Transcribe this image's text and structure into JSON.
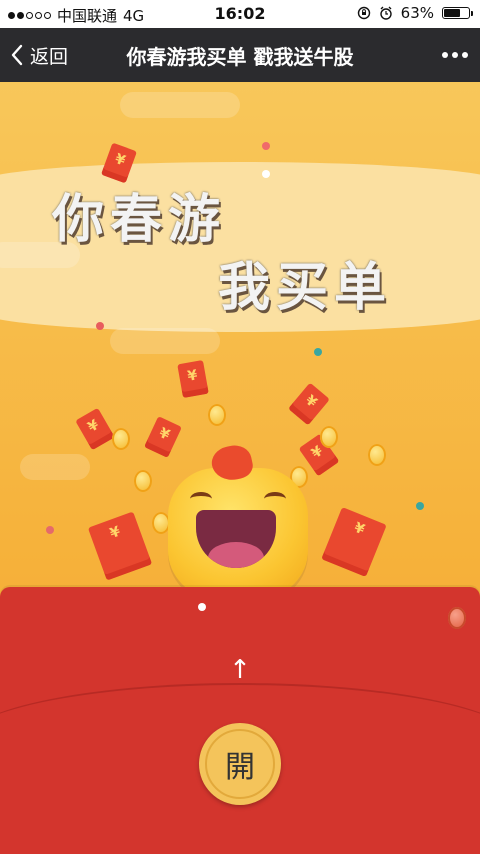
{
  "status_bar": {
    "carrier": "中国联通",
    "network": "4G",
    "time": "16:02",
    "battery": "63%",
    "battery_level": 0.63
  },
  "nav": {
    "back_label": "返回",
    "title": "你春游我买单 戳我送牛股"
  },
  "hero": {
    "line1": "你春游",
    "line2": "我买单"
  },
  "envelope": {
    "arrow": "↑",
    "open_label": "開"
  }
}
